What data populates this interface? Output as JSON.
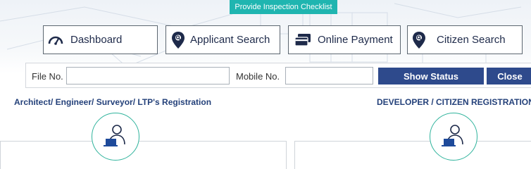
{
  "banner": {
    "label": "Provide Inspection Checklist"
  },
  "nav": {
    "dashboard": {
      "label": "Dashboard",
      "icon": "speedometer-icon"
    },
    "applicant_search": {
      "label": "Applicant Search",
      "icon": "map-pin-search-icon"
    },
    "online_payment": {
      "label": "Online Payment",
      "icon": "credit-card-icon"
    },
    "citizen_search": {
      "label": "Citizen Search",
      "icon": "map-pin-search-icon"
    }
  },
  "filter": {
    "file_no_label": "File No.",
    "file_no_value": "",
    "mobile_no_label": "Mobile No.",
    "mobile_no_value": "",
    "show_status_label": "Show Status",
    "close_label": "Close"
  },
  "sections": {
    "professional_title": "Architect/ Engineer/ Surveyor/ LTP's Registration",
    "developer_title": "DEVELOPER / CITIZEN REGISTRATION",
    "icon": "user-laptop-icon"
  },
  "colors": {
    "banner": "#1fb5b0",
    "button": "#2e4a8c",
    "heading": "#24417a",
    "icon_accent": "#2fb39c"
  }
}
